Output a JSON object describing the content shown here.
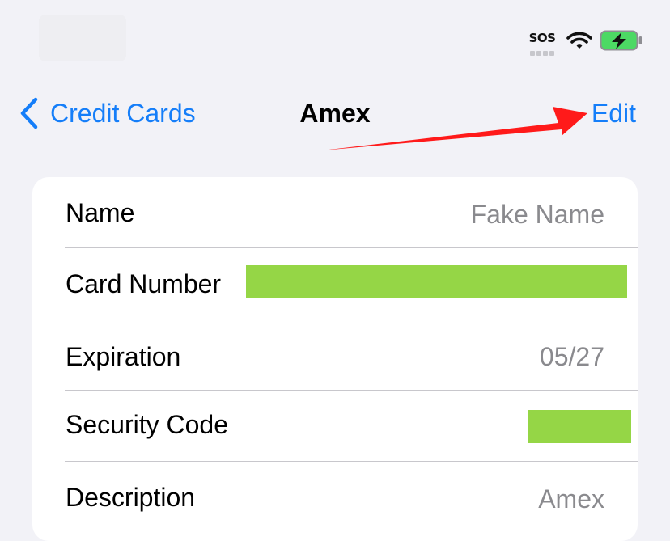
{
  "status": {
    "sos": "SOS",
    "icons": [
      "wifi-icon",
      "battery-charging-icon"
    ],
    "battery_color": "#4cd964"
  },
  "nav": {
    "back_label": "Credit Cards",
    "title": "Amex",
    "edit_label": "Edit",
    "accent_color": "#157ef9"
  },
  "annotation": {
    "arrow_color": "#ff1a1a"
  },
  "card": {
    "rows": [
      {
        "label": "Name",
        "value": "Fake Name"
      },
      {
        "label": "Card Number",
        "value": ""
      },
      {
        "label": "Expiration",
        "value": "05/27"
      },
      {
        "label": "Security Code",
        "value": ""
      },
      {
        "label": "Description",
        "value": "Amex"
      }
    ],
    "redaction_color": "#95d646"
  }
}
